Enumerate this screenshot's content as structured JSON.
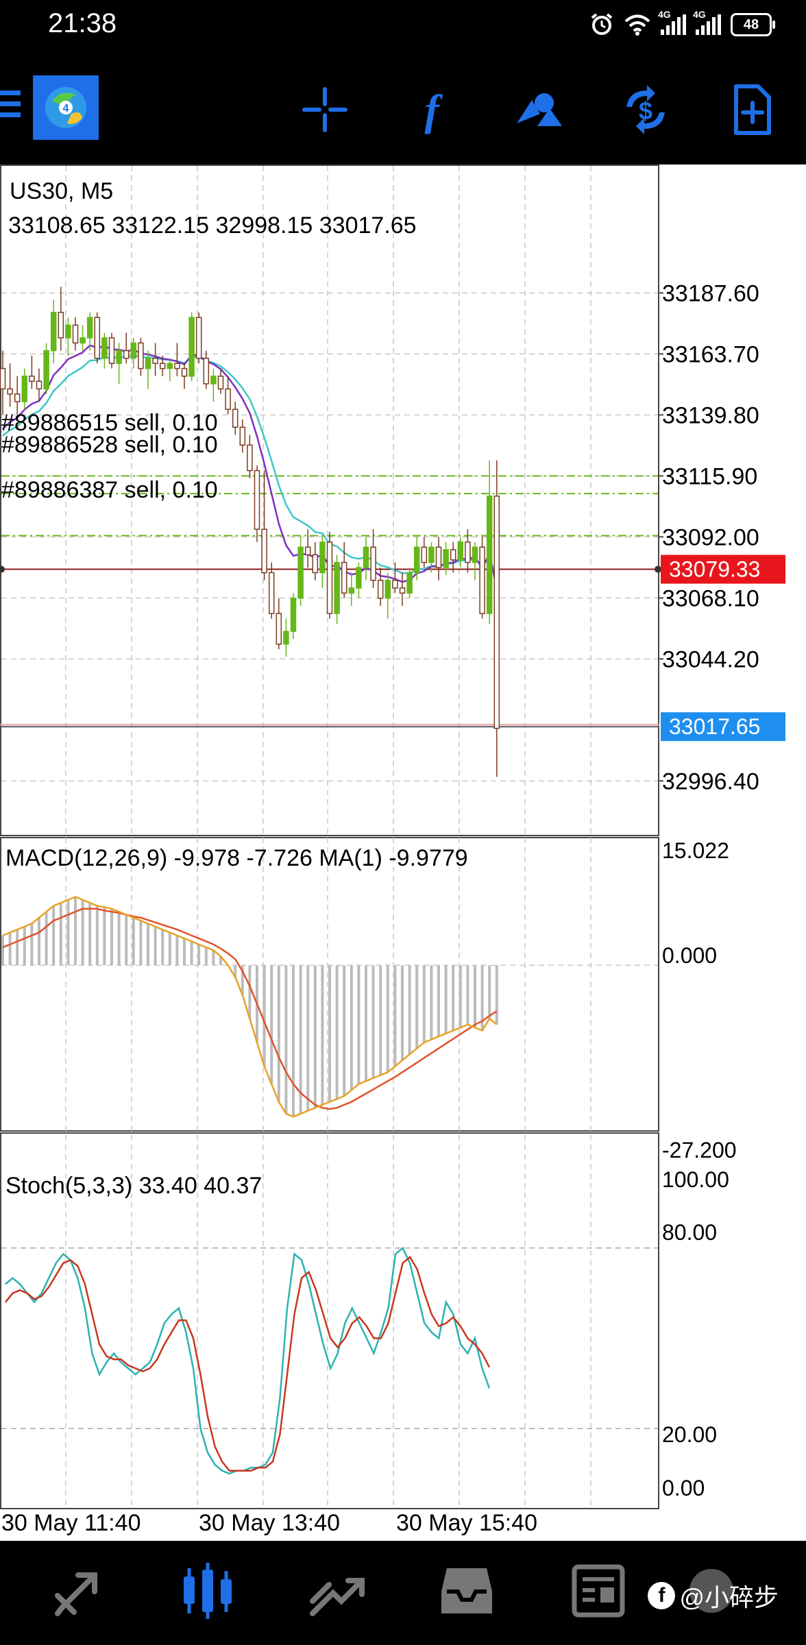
{
  "status_bar": {
    "time": "21:38",
    "network_1": "4G",
    "network_2": "4G",
    "battery": "48",
    "icons": [
      "alarm-icon",
      "wifi-icon",
      "signal-icon",
      "signal-icon",
      "battery-icon"
    ]
  },
  "toolbar": {
    "icons": [
      "menu-icon",
      "app-logo",
      "crosshair-icon",
      "indicators-icon",
      "objects-icon",
      "trade-icon",
      "new-order-icon"
    ],
    "accent": "#1e6fe8"
  },
  "chart": {
    "symbol_timeframe": "US30, M5",
    "ohlc": "33108.65 33122.15 32998.15 33017.65",
    "orders": [
      {
        "label": "#89886515 sell, 0.10",
        "price": 33115.9
      },
      {
        "label": "#89886528 sell, 0.10",
        "price": 33109.0
      },
      {
        "label": "#89886387 sell, 0.10",
        "price": 33092.5
      }
    ],
    "price_ticks": [
      "33187.60",
      "33163.70",
      "33139.80",
      "33115.90",
      "33092.00",
      "33068.10",
      "33044.20",
      "32996.40"
    ],
    "bid_label": "33079.33",
    "bid_price": 33079.33,
    "last_label": "33017.65",
    "last_price": 33017.65,
    "bid_color": "#e8161c",
    "last_color": "#1e8ff0",
    "bull_color": "#66b718",
    "bear_color": "#7a3b20",
    "macd_label": "MACD(12,26,9) -9.978 -7.726 MA(1) -9.9779",
    "macd_ticks": [
      "15.022",
      "0.000",
      "-27.200"
    ],
    "stoch_label": "Stoch(5,3,3) 33.40 40.37",
    "stoch_ticks": [
      "100.00",
      "80.00",
      "20.00",
      "0.00"
    ],
    "time_labels": [
      "30 May 11:40",
      "30 May 13:40",
      "30 May 15:40"
    ]
  },
  "chart_data": [
    {
      "type": "candlestick",
      "title": "US30, M5",
      "ylim": [
        32975,
        33210
      ],
      "ohlc": [
        [
          33158,
          33165,
          33140,
          33150
        ],
        [
          33150,
          33160,
          33143,
          33148
        ],
        [
          33148,
          33155,
          33140,
          33145
        ],
        [
          33145,
          33158,
          33142,
          33155
        ],
        [
          33155,
          33163,
          33150,
          33153
        ],
        [
          33153,
          33158,
          33145,
          33150
        ],
        [
          33150,
          33168,
          33148,
          33165
        ],
        [
          33165,
          33185,
          33160,
          33180
        ],
        [
          33180,
          33190,
          33165,
          33170
        ],
        [
          33170,
          33178,
          33163,
          33175
        ],
        [
          33175,
          33178,
          33165,
          33168
        ],
        [
          33168,
          33175,
          33165,
          33170
        ],
        [
          33170,
          33180,
          33165,
          33178
        ],
        [
          33178,
          33180,
          33160,
          33162
        ],
        [
          33162,
          33172,
          33158,
          33170
        ],
        [
          33170,
          33172,
          33158,
          33160
        ],
        [
          33160,
          33168,
          33152,
          33165
        ],
        [
          33165,
          33172,
          33160,
          33162
        ],
        [
          33162,
          33170,
          33158,
          33168
        ],
        [
          33168,
          33170,
          33155,
          33158
        ],
        [
          33158,
          33165,
          33150,
          33162
        ],
        [
          33162,
          33168,
          33155,
          33160
        ],
        [
          33160,
          33163,
          33155,
          33158
        ],
        [
          33158,
          33162,
          33153,
          33160
        ],
        [
          33160,
          33168,
          33155,
          33158
        ],
        [
          33158,
          33160,
          33150,
          33155
        ],
        [
          33155,
          33180,
          33153,
          33178
        ],
        [
          33178,
          33180,
          33160,
          33162
        ],
        [
          33162,
          33165,
          33150,
          33152
        ],
        [
          33152,
          33158,
          33145,
          33155
        ],
        [
          33155,
          33158,
          33148,
          33150
        ],
        [
          33150,
          33155,
          33140,
          33142
        ],
        [
          33142,
          33145,
          33132,
          33135
        ],
        [
          33135,
          33138,
          33125,
          33128
        ],
        [
          33128,
          33132,
          33115,
          33118
        ],
        [
          33118,
          33120,
          33090,
          33095
        ],
        [
          33095,
          33118,
          33075,
          33078
        ],
        [
          33078,
          33082,
          33060,
          33062
        ],
        [
          33062,
          33068,
          33048,
          33050
        ],
        [
          33050,
          33060,
          33045,
          33055
        ],
        [
          33055,
          33070,
          33052,
          33068
        ],
        [
          33068,
          33092,
          33065,
          33088
        ],
        [
          33088,
          33095,
          33080,
          33085
        ],
        [
          33085,
          33090,
          33075,
          33078
        ],
        [
          33078,
          33092,
          33072,
          33090
        ],
        [
          33090,
          33094,
          33060,
          33062
        ],
        [
          33062,
          33085,
          33058,
          33082
        ],
        [
          33082,
          33090,
          33068,
          33070
        ],
        [
          33070,
          33078,
          33065,
          33072
        ],
        [
          33072,
          33082,
          33068,
          33080
        ],
        [
          33080,
          33092,
          33075,
          33088
        ],
        [
          33088,
          33095,
          33072,
          33075
        ],
        [
          33075,
          33080,
          33065,
          33068
        ],
        [
          33068,
          33078,
          33060,
          33075
        ],
        [
          33075,
          33082,
          33070,
          33072
        ],
        [
          33072,
          33078,
          33065,
          33070
        ],
        [
          33070,
          33080,
          33068,
          33078
        ],
        [
          33078,
          33092,
          33075,
          33088
        ],
        [
          33088,
          33092,
          33080,
          33082
        ],
        [
          33082,
          33090,
          33078,
          33088
        ],
        [
          33088,
          33092,
          33075,
          33080
        ],
        [
          33080,
          33090,
          33077,
          33087
        ],
        [
          33087,
          33090,
          33078,
          33083
        ],
        [
          33083,
          33092,
          33080,
          33090
        ],
        [
          33090,
          33095,
          33078,
          33082
        ],
        [
          33082,
          33090,
          33075,
          33088
        ],
        [
          33088,
          33092,
          33060,
          33062
        ],
        [
          33062,
          33122,
          33058,
          33108
        ],
        [
          33108,
          33122,
          32998,
          33017
        ]
      ]
    },
    {
      "type": "line",
      "title": "MACD(12,26,9)",
      "ylim": [
        -27.2,
        15.022
      ],
      "series": [
        {
          "name": "MACD",
          "values": [
            5,
            5.5,
            6,
            6.5,
            7,
            8,
            9,
            10,
            10.5,
            11,
            11.5,
            11,
            10.5,
            10,
            9.8,
            9.5,
            9,
            8.5,
            8,
            7.5,
            7,
            6.5,
            6,
            5.5,
            5,
            4.5,
            4,
            3.5,
            3,
            2.5,
            1.5,
            0,
            -2,
            -5,
            -9,
            -13,
            -17,
            -20,
            -23,
            -25,
            -25.5,
            -25,
            -24.5,
            -24,
            -23.5,
            -23,
            -22.5,
            -22,
            -21,
            -20,
            -19.5,
            -19,
            -18.5,
            -18,
            -17,
            -16,
            -15,
            -14,
            -13,
            -12.5,
            -12,
            -11.5,
            -11,
            -10.5,
            -10,
            -10.5,
            -11,
            -9,
            -9.978
          ]
        },
        {
          "name": "Signal",
          "values": [
            3,
            3.5,
            4,
            4.5,
            5,
            5.5,
            6.5,
            7.5,
            8,
            8.5,
            9,
            9.5,
            9.5,
            9.5,
            9.2,
            9,
            8.8,
            8.5,
            8.2,
            8,
            7.6,
            7.2,
            6.8,
            6.4,
            6,
            5.5,
            5,
            4.5,
            4,
            3.5,
            2.8,
            2,
            1,
            -1,
            -3.5,
            -6.5,
            -9.5,
            -12.5,
            -15.5,
            -18,
            -20,
            -21.5,
            -22.5,
            -23.5,
            -24,
            -24.2,
            -24,
            -23.5,
            -23,
            -22.3,
            -21.6,
            -20.9,
            -20.2,
            -19.5,
            -18.8,
            -18,
            -17.2,
            -16.4,
            -15.6,
            -14.8,
            -14,
            -13.2,
            -12.4,
            -11.6,
            -10.8,
            -10,
            -9.4,
            -8.5,
            -7.726
          ]
        }
      ]
    },
    {
      "type": "line",
      "title": "Stoch(5,3,3)",
      "ylim": [
        0,
        100
      ],
      "series": [
        {
          "name": "Main",
          "values": [
            68,
            70,
            68,
            65,
            62,
            65,
            70,
            75,
            78,
            76,
            70,
            60,
            45,
            38,
            42,
            45,
            42,
            40,
            38,
            40,
            42,
            48,
            55,
            58,
            60,
            52,
            40,
            20,
            12,
            8,
            6,
            5,
            6,
            6,
            7,
            7,
            8,
            12,
            30,
            60,
            78,
            76,
            68,
            58,
            48,
            40,
            45,
            55,
            60,
            55,
            50,
            45,
            52,
            60,
            78,
            80,
            75,
            65,
            55,
            52,
            50,
            62,
            58,
            48,
            45,
            50,
            40,
            33.4
          ]
        },
        {
          "name": "Signal",
          "values": [
            62,
            65,
            66,
            65,
            63,
            64,
            67,
            71,
            75,
            76,
            74,
            68,
            58,
            48,
            44,
            43,
            43,
            41,
            40,
            39,
            40,
            43,
            48,
            52,
            56,
            56,
            50,
            38,
            24,
            14,
            9,
            6,
            6,
            6,
            6,
            7,
            7,
            9,
            18,
            38,
            58,
            70,
            72,
            66,
            58,
            50,
            47,
            50,
            55,
            57,
            54,
            50,
            50,
            55,
            65,
            75,
            77,
            73,
            65,
            58,
            54,
            55,
            57,
            54,
            50,
            48,
            45,
            40.37
          ]
        }
      ]
    }
  ]
}
